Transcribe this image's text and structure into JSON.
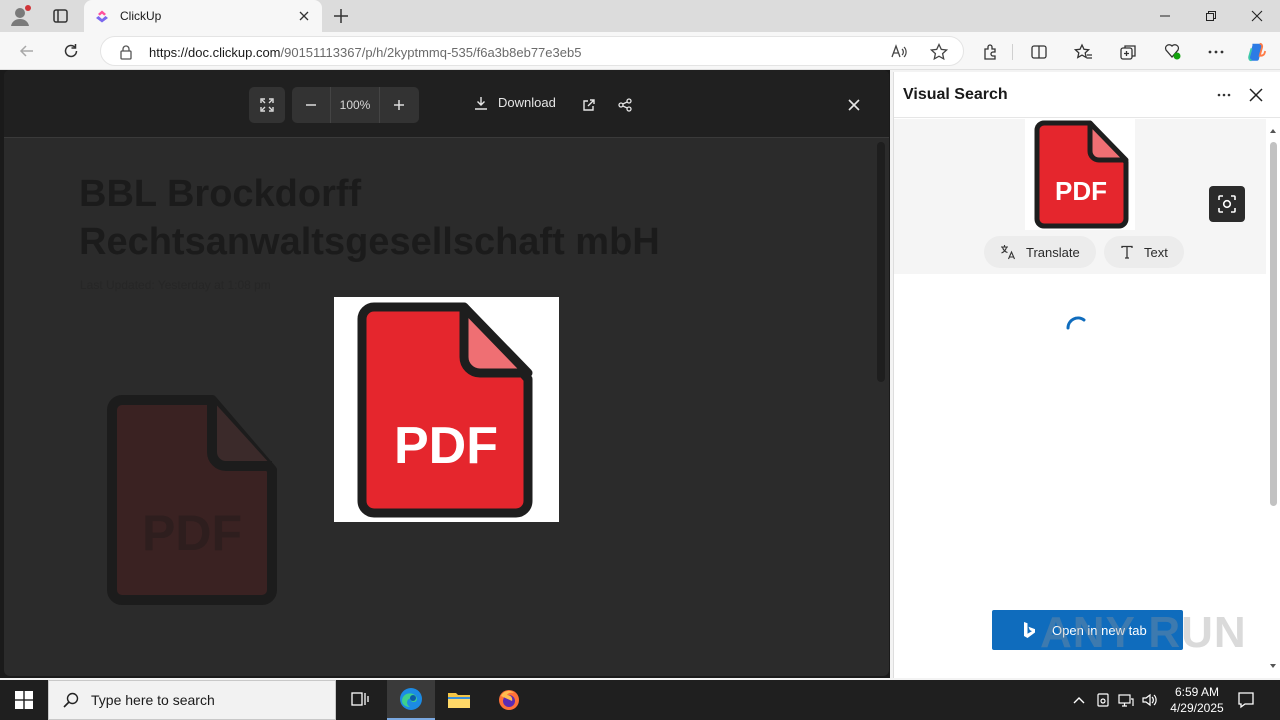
{
  "browser": {
    "tab": {
      "title": "ClickUp"
    },
    "url": {
      "host": "https://doc.clickup.com",
      "path": "/90151113367/p/h/2kyptmmq-535/f6a3b8eb77e3eb5"
    }
  },
  "viewer": {
    "zoom": "100%",
    "download_label": "Download"
  },
  "document": {
    "title_line1": "BBL Brockdorff",
    "title_line2": "Rechtsanwaltsgesellschaft mbH",
    "updated": "Last Updated: Yesterday at 1:08 pm"
  },
  "icons": {
    "pdf_label": "PDF"
  },
  "visual_search": {
    "title": "Visual Search",
    "chip_translate": "Translate",
    "chip_text": "Text",
    "open_new_tab": "Open in new tab",
    "watermark": "ANY RUN"
  },
  "taskbar": {
    "search_placeholder": "Type here to search",
    "time": "6:59 AM",
    "date": "4/29/2025"
  },
  "colors": {
    "pdf_red": "#e5262d",
    "pdf_corner": "#ef6f73",
    "accent_blue": "#0f6cbd"
  }
}
